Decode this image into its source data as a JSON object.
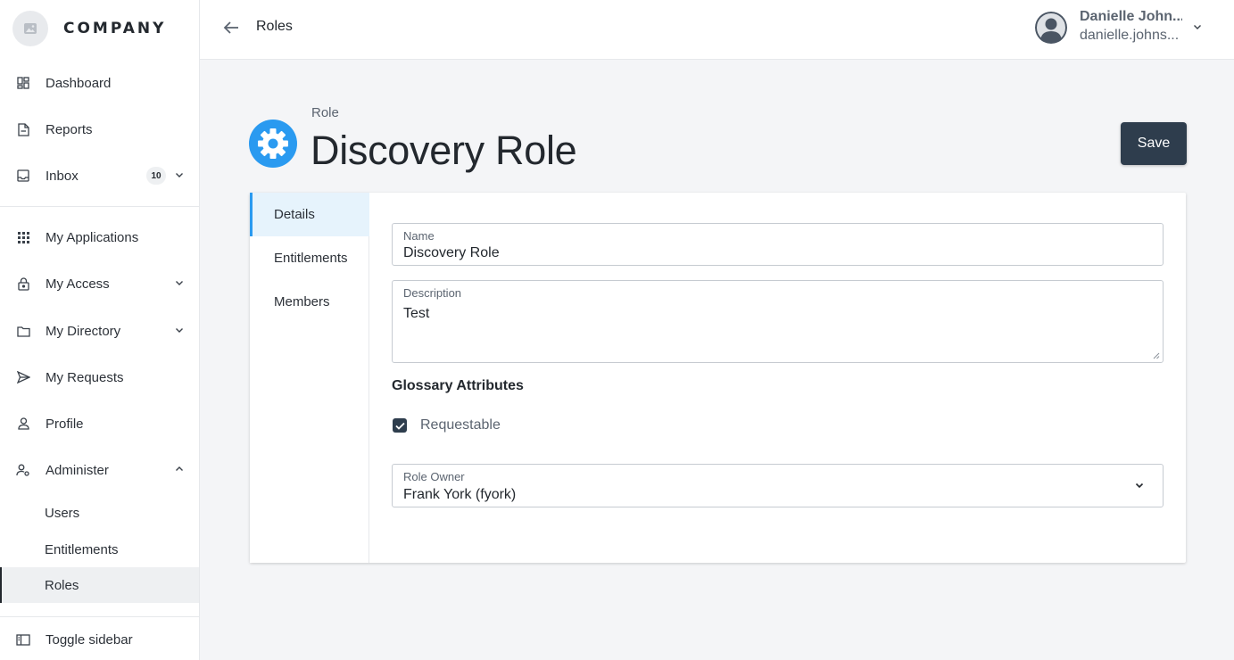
{
  "brand": {
    "name": "COMPANY"
  },
  "sidebar": {
    "items": [
      {
        "label": "Dashboard"
      },
      {
        "label": "Reports"
      },
      {
        "label": "Inbox",
        "badge": "10"
      },
      {
        "label": "My Applications"
      },
      {
        "label": "My Access"
      },
      {
        "label": "My Directory"
      },
      {
        "label": "My Requests"
      },
      {
        "label": "Profile"
      },
      {
        "label": "Administer"
      }
    ],
    "sub_items": [
      {
        "label": "Users"
      },
      {
        "label": "Entitlements"
      },
      {
        "label": "Roles"
      }
    ],
    "toggle_label": "Toggle sidebar"
  },
  "header": {
    "title": "Roles",
    "user_name": "Danielle John...",
    "user_email": "danielle.johns..."
  },
  "page": {
    "eyebrow": "Role",
    "title": "Discovery Role",
    "save_label": "Save"
  },
  "tabs": [
    {
      "label": "Details"
    },
    {
      "label": "Entitlements"
    },
    {
      "label": "Members"
    }
  ],
  "form": {
    "name_label": "Name",
    "name_value": "Discovery Role",
    "description_label": "Description",
    "description_value": "Test",
    "section_title": "Glossary Attributes",
    "requestable_label": "Requestable",
    "owner_label": "Role Owner",
    "owner_value": "Frank York (fyork)"
  },
  "colors": {
    "accent": "#2a9af0",
    "primary_button": "#2e3d4d",
    "active_tab_bg": "#e6f3fc"
  }
}
